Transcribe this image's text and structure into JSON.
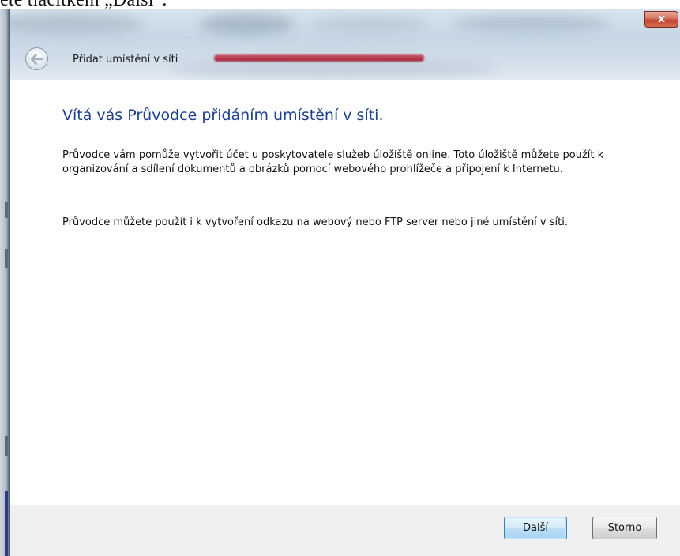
{
  "caption": "ete tlačítkem „Další“.",
  "window": {
    "title": "Přidat umístění v síti",
    "close_symbol": "x"
  },
  "content": {
    "heading": "Vítá vás Průvodce přidáním umístění v síti.",
    "paragraph1": "Průvodce vám pomůže vytvořit účet u poskytovatele služeb úložiště online. Toto úložiště můžete použít k organizování a sdílení dokumentů a obrázků pomocí webového prohlížeče a připojení k Internetu.",
    "paragraph2": "Průvodce můžete použít i k vytvoření odkazu na webový nebo FTP server nebo jiné umístění v síti."
  },
  "buttons": {
    "next": "Další",
    "cancel": "Storno"
  },
  "colors": {
    "heading": "#1e3f8c",
    "footer": "#f0f0f0",
    "close_button": "#c24633"
  },
  "icons": {
    "back": "back-arrow-icon",
    "close": "close-icon"
  }
}
